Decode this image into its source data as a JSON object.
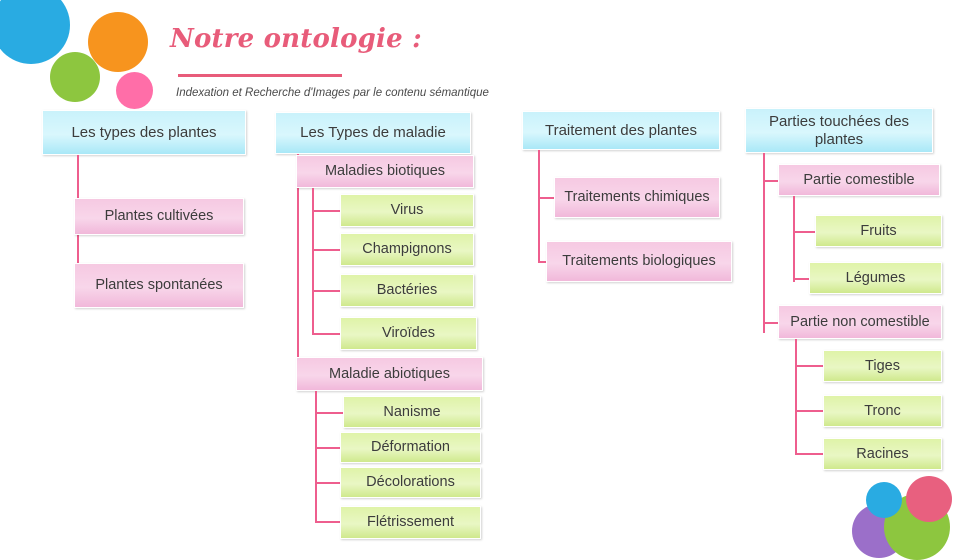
{
  "header": {
    "title": "Notre ontologie :",
    "subtitle": "Indexation et Recherche d'Images par le contenu sémantique"
  },
  "colors": {
    "accent_pink": "#E85C7A",
    "connector_pink": "#EE5E8E",
    "node_cyan": "#cdf3fb",
    "node_pink": "#f6c9e2",
    "node_green": "#dff3a8",
    "deco_blue": "#29ABE2",
    "deco_orange": "#F7941E",
    "deco_green": "#8DC63F",
    "deco_violet": "#9B6FC9"
  },
  "diagram": {
    "columns": [
      {
        "root": "Les types des plantes",
        "children": [
          "Plantes cultivées",
          "Plantes spontanées"
        ]
      },
      {
        "root": "Les Types de maladie",
        "children": [
          "Maladies biotiques",
          "Virus",
          "Champignons",
          "Bactéries",
          "Viroïdes",
          "Maladie abiotiques",
          "Nanisme",
          "Déformation",
          "Décolorations",
          "Flétrissement"
        ]
      },
      {
        "root": "Traitement des plantes",
        "children": [
          "Traitements chimiques",
          "Traitements biologiques"
        ]
      },
      {
        "root": "Parties touchées des plantes",
        "children": [
          "Partie comestible",
          "Fruits",
          "Légumes",
          "Partie non comestible",
          "Tiges",
          "Tronc",
          "Racines"
        ]
      }
    ]
  }
}
